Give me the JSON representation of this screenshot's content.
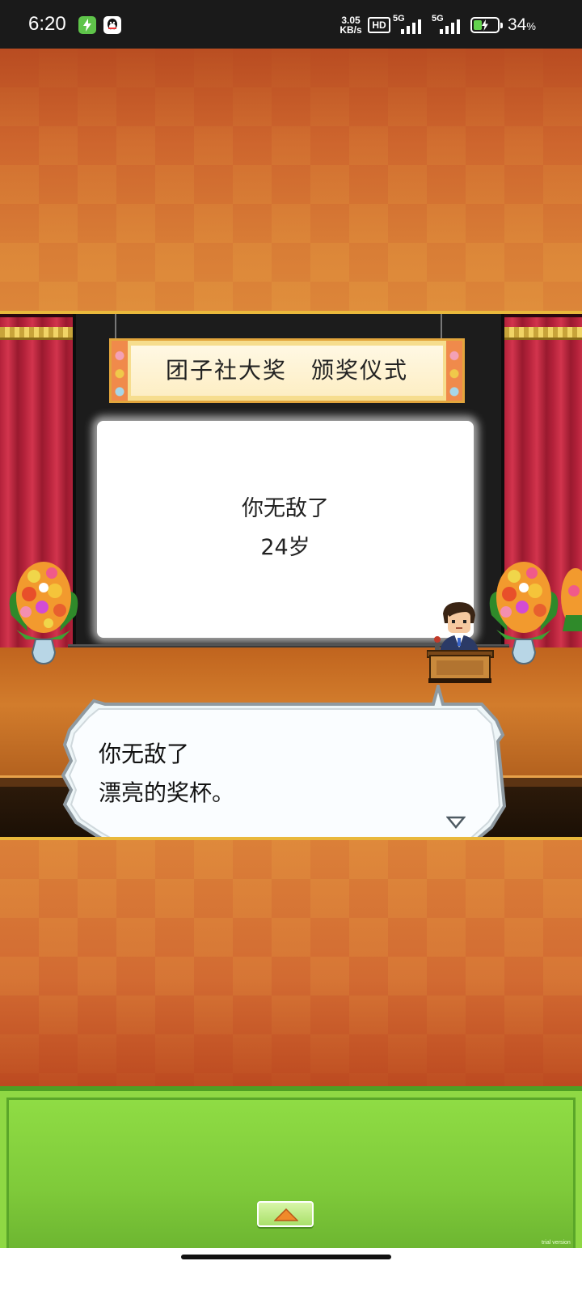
{
  "status_bar": {
    "time": "6:20",
    "net_speed_value": "3.05",
    "net_speed_unit": "KB/s",
    "hd_label": "HD",
    "network_1": "5G",
    "network_2": "5G",
    "battery_percent": "34",
    "battery_percent_symbol": "%",
    "battery_level": 0.34,
    "icons": [
      "charging-app-icon",
      "qq-icon",
      "signal-icon",
      "signal-icon",
      "battery-charging-icon"
    ]
  },
  "scene": {
    "banner_title": "团子社大奖　颁奖仪式",
    "screen_lines": [
      "你无敌了",
      "24岁"
    ]
  },
  "dialog": {
    "lines": [
      "你无敌了",
      "漂亮的奖杯。"
    ]
  },
  "bottom_panel": {
    "expand_icon": "triangle-up-icon",
    "watermark": "trial version"
  },
  "colors": {
    "status_bar_bg": "#1a1a1a",
    "checker_orange": "#d46e34",
    "curtain_red": "#b3213a",
    "panel_green": "#8fd844",
    "banner_cream": "#f6dd8e"
  }
}
